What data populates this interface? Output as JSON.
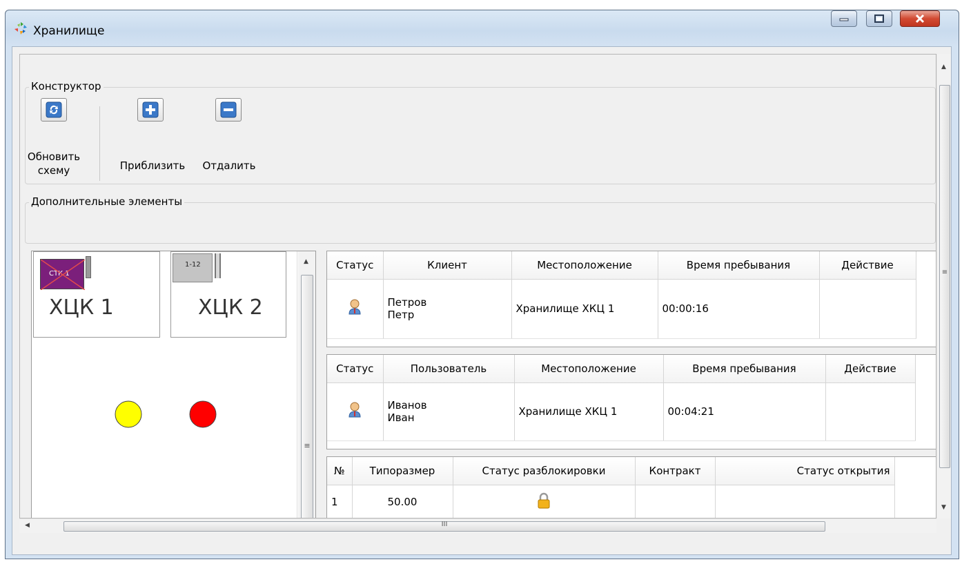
{
  "window": {
    "title": "Хранилище"
  },
  "constructor_group": {
    "title": "Конструктор",
    "refresh_label_line1": "Обновить",
    "refresh_label_line2": "схему",
    "zoom_in_label": "Приблизить",
    "zoom_out_label": "Отдалить"
  },
  "extra_group": {
    "title": "Дополнительные элементы"
  },
  "scheme": {
    "cells": [
      {
        "name": "ХЦК 1",
        "tag": "СТК 1",
        "tag_color": "#7b1f7b",
        "tag_crossed": true
      },
      {
        "name": "ХЦК 2",
        "tag": "1-12",
        "tag_color": "#c4c4c4",
        "tag_crossed": false
      }
    ],
    "indicators": [
      {
        "color": "#ffff00"
      },
      {
        "color": "#ff0000"
      }
    ]
  },
  "clients_table": {
    "columns": [
      "Статус",
      "Клиент",
      "Местоположение",
      "Время пребывания",
      "Действие"
    ],
    "rows": [
      {
        "status_icon": "user-icon",
        "name_line1": "Петров",
        "name_line2": "Петр",
        "location": "Хранилище ХКЦ 1",
        "time": "00:00:16",
        "action": ""
      }
    ]
  },
  "users_table": {
    "columns": [
      "Статус",
      "Пользователь",
      "Местоположение",
      "Время пребывания",
      "Действие"
    ],
    "rows": [
      {
        "status_icon": "user-icon",
        "name_line1": "Иванов",
        "name_line2": "Иван",
        "location": "Хранилище ХКЦ 1",
        "time": "00:04:21",
        "action": ""
      }
    ]
  },
  "boxes_table": {
    "columns": [
      "№",
      "Типоразмер",
      "Статус разблокировки",
      "Контракт",
      "Статус открытия"
    ],
    "rows": [
      {
        "num": "1",
        "size": "50.00",
        "unlock_icon": "lock-icon",
        "contract": "",
        "open_status": ""
      }
    ]
  },
  "scroll": {
    "h_grip": "III",
    "v_grip": "≡"
  }
}
